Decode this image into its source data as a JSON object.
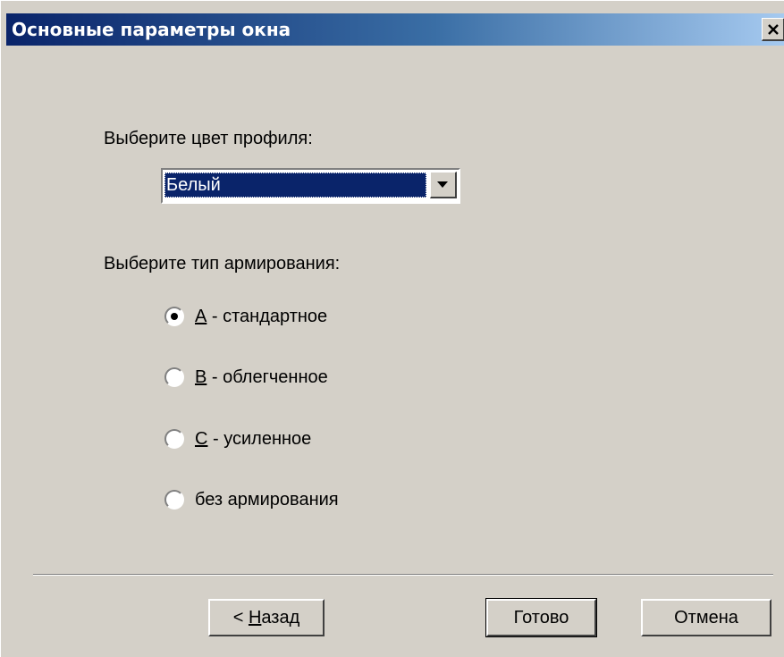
{
  "window": {
    "title": "Основные параметры окна",
    "close_glyph": "✕"
  },
  "profile": {
    "label": "Выберите цвет профиля:",
    "selected": "Белый"
  },
  "reinforcement": {
    "label": "Выберите тип армирования:",
    "options": [
      {
        "key": "А",
        "rest": " - стандартное",
        "checked": true
      },
      {
        "key": "В",
        "rest": " - облегченное",
        "checked": false
      },
      {
        "key": "С",
        "rest": " - усиленное",
        "checked": false
      },
      {
        "key": "",
        "rest": "без армирования",
        "checked": false
      }
    ]
  },
  "buttons": {
    "back_prefix": "< ",
    "back_key": "Н",
    "back_rest": "азад",
    "finish": "Готово",
    "cancel": "Отмена"
  },
  "icons": {
    "close": "close-icon",
    "dropdown": "triangle-down-icon"
  }
}
